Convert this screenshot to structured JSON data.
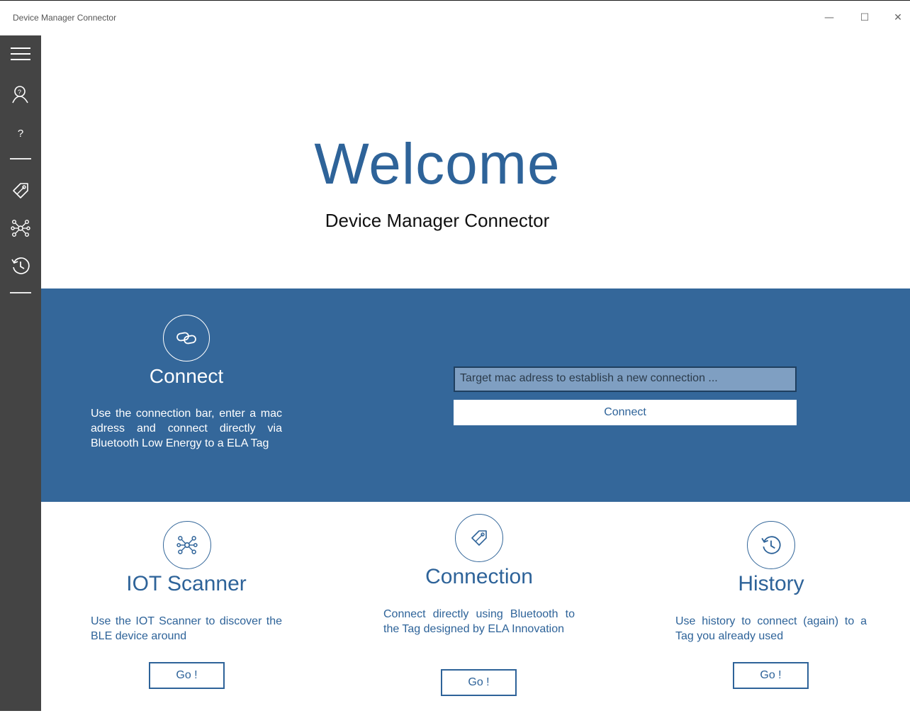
{
  "window": {
    "title": "Device Manager Connector",
    "minimize": "—",
    "maximize": "☐",
    "close": "✕"
  },
  "sidebar": {
    "items": [
      {
        "icon": "hamburger-menu-icon"
      },
      {
        "icon": "person-help-icon"
      },
      {
        "icon": "question-mark-icon",
        "label": "?"
      },
      {
        "icon": "tag-icon"
      },
      {
        "icon": "network-icon"
      },
      {
        "icon": "history-icon"
      }
    ]
  },
  "hero": {
    "welcome": "Welcome",
    "subtitle": "Device Manager Connector"
  },
  "connect_section": {
    "title": "Connect",
    "description": "Use the connection bar, enter a mac adress and connect directly via Bluetooth Low Energy to a ELA Tag",
    "input_placeholder": "Target mac adress to establish a new connection ...",
    "button_label": "Connect"
  },
  "cards": [
    {
      "title": "IOT Scanner",
      "description": "Use the IOT Scanner to discover the BLE device around",
      "button_label": "Go !",
      "icon": "network-icon"
    },
    {
      "title": "Connection",
      "description": "Connect directly using Bluetooth to the Tag designed by ELA Innovation",
      "button_label": "Go !",
      "icon": "tag-icon"
    },
    {
      "title": "History",
      "description": "Use history to connect (again) to a Tag you already used",
      "button_label": "Go !",
      "icon": "history-icon"
    }
  ],
  "colors": {
    "accent": "#2e6399",
    "band": "#34679a",
    "sidebar": "#444444"
  }
}
